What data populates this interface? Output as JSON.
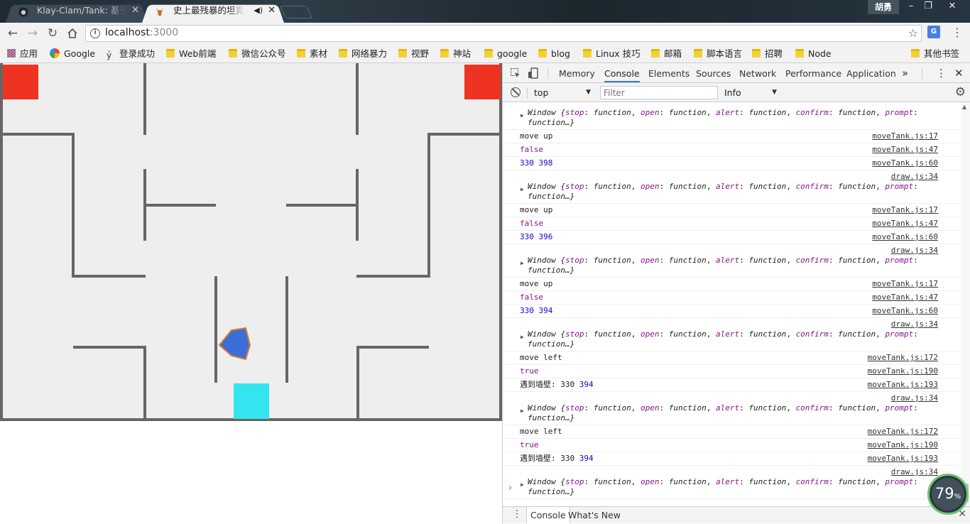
{
  "browser": {
    "tabs": [
      {
        "title": "Klay-Clam/Tank: 基于N",
        "active": false
      },
      {
        "title": "史上最残暴的坦克大战",
        "active": true
      }
    ],
    "profile_name": "胡勇",
    "window_controls": {
      "minimize": "–",
      "restore": "❐",
      "close": "✕"
    },
    "url_host": "localhost",
    "url_port": ":3000",
    "translate_ext_label": "G"
  },
  "bookmarks": [
    {
      "label": "应用",
      "icon": "apps-icon"
    },
    {
      "label": "Google",
      "icon": "google-icon"
    },
    {
      "label": "登录成功",
      "icon": "rabbit-icon"
    },
    {
      "label": "Web前端",
      "icon": "folder-icon"
    },
    {
      "label": "微信公众号",
      "icon": "folder-icon"
    },
    {
      "label": "素材",
      "icon": "folder-icon"
    },
    {
      "label": "网络暴力",
      "icon": "folder-icon"
    },
    {
      "label": "视野",
      "icon": "folder-icon"
    },
    {
      "label": "神站",
      "icon": "folder-icon"
    },
    {
      "label": "google",
      "icon": "folder-icon"
    },
    {
      "label": "blog",
      "icon": "folder-icon"
    },
    {
      "label": "Linux 技巧",
      "icon": "folder-icon"
    },
    {
      "label": "邮箱",
      "icon": "folder-icon"
    },
    {
      "label": "脚本语言",
      "icon": "folder-icon"
    },
    {
      "label": "招聘",
      "icon": "folder-icon"
    },
    {
      "label": "Node",
      "icon": "folder-icon"
    },
    {
      "label": "其他书签",
      "icon": "folder-icon"
    }
  ],
  "game": {
    "colors": {
      "background": "#eeeeee",
      "wall": "#666666",
      "enemy": "#ee3322",
      "base": "#33e5ee",
      "player_fill": "#3a6fd8",
      "player_stroke": "#e07a2e"
    }
  },
  "devtools": {
    "tabs": [
      "Memory",
      "Console",
      "Elements",
      "Sources",
      "Network",
      "Performance",
      "Application"
    ],
    "active_tab": "Console",
    "more": "»",
    "context": "top",
    "filter_placeholder": "Filter",
    "level": "Info",
    "drawer_tabs": [
      "Console",
      "What's New"
    ],
    "window_obj": {
      "prefix": "Window {",
      "pairs": [
        [
          "stop",
          "function"
        ],
        [
          "open",
          "function"
        ],
        [
          "alert",
          "function"
        ],
        [
          "confirm",
          "function"
        ]
      ],
      "tail_key": "prompt",
      "tail": "function…}"
    },
    "log": [
      {
        "kind": "obj",
        "src": ""
      },
      {
        "kind": "text",
        "msg": "move up",
        "src": "moveTank.js:17"
      },
      {
        "kind": "bool",
        "msg": "false",
        "src": "moveTank.js:47"
      },
      {
        "kind": "nums",
        "msg": "330 398",
        "src": "moveTank.js:60"
      },
      {
        "kind": "obj",
        "src": "draw.js:34"
      },
      {
        "kind": "text",
        "msg": "move up",
        "src": "moveTank.js:17"
      },
      {
        "kind": "bool",
        "msg": "false",
        "src": "moveTank.js:47"
      },
      {
        "kind": "nums",
        "msg": "330 396",
        "src": "moveTank.js:60"
      },
      {
        "kind": "obj",
        "src": "draw.js:34"
      },
      {
        "kind": "text",
        "msg": "move up",
        "src": "moveTank.js:17"
      },
      {
        "kind": "bool",
        "msg": "false",
        "src": "moveTank.js:47"
      },
      {
        "kind": "nums",
        "msg": "330 394",
        "src": "moveTank.js:60"
      },
      {
        "kind": "obj",
        "src": "draw.js:34"
      },
      {
        "kind": "text",
        "msg": "move left",
        "src": "moveTank.js:172"
      },
      {
        "kind": "bool",
        "msg": "true",
        "src": "moveTank.js:190"
      },
      {
        "kind": "wall",
        "label": "遇到墙壁: 330 ",
        "num": "394",
        "src": "moveTank.js:193"
      },
      {
        "kind": "obj",
        "src": "draw.js:34"
      },
      {
        "kind": "text",
        "msg": "move left",
        "src": "moveTank.js:172"
      },
      {
        "kind": "bool",
        "msg": "true",
        "src": "moveTank.js:190"
      },
      {
        "kind": "wall",
        "label": "遇到墙壁: 330 ",
        "num": "394",
        "src": "moveTank.js:193"
      },
      {
        "kind": "obj",
        "src": "draw.js:34"
      }
    ]
  },
  "overlay": {
    "value": "79",
    "unit": "%"
  }
}
